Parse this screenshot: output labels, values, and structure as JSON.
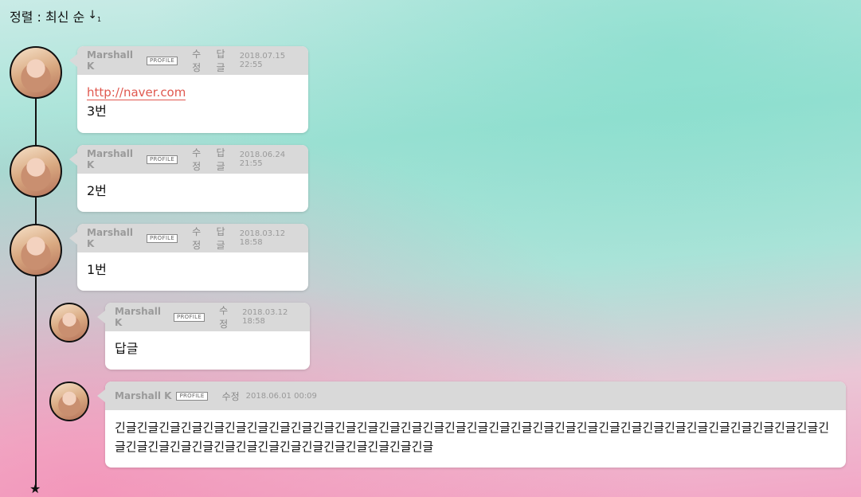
{
  "sort": {
    "label": "정렬 : 최신 순",
    "icon": "sort-descending-icon"
  },
  "comments": [
    {
      "author": "Marshall K",
      "badge": "PROFILE",
      "edit": "수정",
      "reply": "답글",
      "date": "2018.07.15 22:55",
      "link": "http://naver.com",
      "text": "3번"
    },
    {
      "author": "Marshall K",
      "badge": "PROFILE",
      "edit": "수정",
      "reply": "답글",
      "date": "2018.06.24 21:55",
      "text": "2번"
    },
    {
      "author": "Marshall K",
      "badge": "PROFILE",
      "edit": "수정",
      "reply": "답글",
      "date": "2018.03.12 18:58",
      "text": "1번"
    },
    {
      "author": "Marshall K",
      "badge": "PROFILE",
      "edit": "수정",
      "date": "2018.03.12 18:58",
      "text": "답글"
    },
    {
      "author": "Marshall K",
      "badge": "PROFILE",
      "edit": "수정",
      "date": "2018.06.01 00:09",
      "text": "긴글긴글긴글긴글긴글긴글긴글긴글긴글긴글긴글긴글긴글긴글긴글긴글긴글긴글긴글긴글긴글긴글긴글긴글긴글긴글긴글긴글긴글긴글긴글긴글긴글긴글긴글긴글긴글긴글긴글긴글긴글긴글긴글긴글긴글긴글긴글"
    }
  ],
  "colors": {
    "link": "#e0584f",
    "header": "#d9d9d9"
  }
}
